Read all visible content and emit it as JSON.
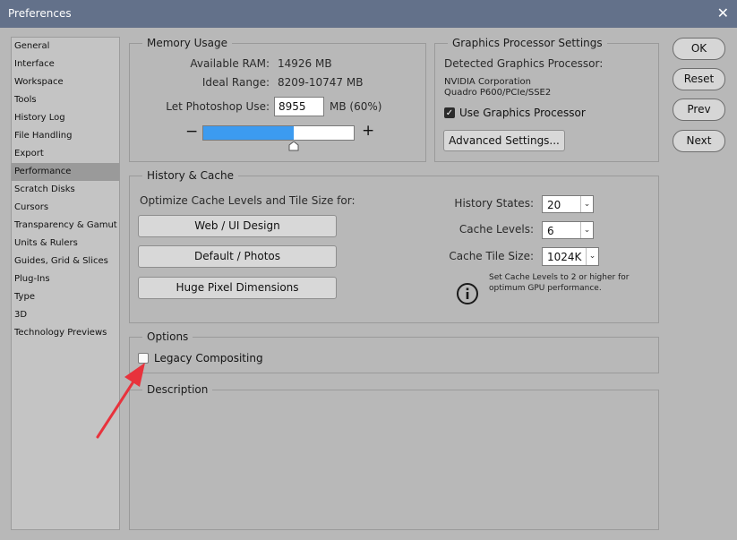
{
  "window": {
    "title": "Preferences",
    "close_glyph": "✕"
  },
  "sidebar": {
    "items": [
      {
        "label": "General"
      },
      {
        "label": "Interface"
      },
      {
        "label": "Workspace"
      },
      {
        "label": "Tools"
      },
      {
        "label": "History Log"
      },
      {
        "label": "File Handling"
      },
      {
        "label": "Export"
      },
      {
        "label": "Performance",
        "selected": true
      },
      {
        "label": "Scratch Disks"
      },
      {
        "label": "Cursors"
      },
      {
        "label": "Transparency & Gamut"
      },
      {
        "label": "Units & Rulers"
      },
      {
        "label": "Guides, Grid & Slices"
      },
      {
        "label": "Plug-Ins"
      },
      {
        "label": "Type"
      },
      {
        "label": "3D"
      },
      {
        "label": "Technology Previews"
      }
    ]
  },
  "memory": {
    "title": "Memory Usage",
    "available_label": "Available RAM:",
    "available_value": "14926 MB",
    "ideal_label": "Ideal Range:",
    "ideal_value": "8209-10747 MB",
    "let_label": "Let Photoshop Use:",
    "let_value": "8955",
    "let_unit": "MB (60%)",
    "slider_fraction": 0.6,
    "minus": "−",
    "plus": "+"
  },
  "gpu": {
    "title": "Graphics Processor Settings",
    "detected_label": "Detected Graphics Processor:",
    "vendor": "NVIDIA Corporation",
    "model": "Quadro P600/PCIe/SSE2",
    "use_gpu_label": "Use Graphics Processor",
    "use_gpu_checked": true,
    "advanced_button": "Advanced Settings..."
  },
  "history": {
    "title": "History & Cache",
    "optimize_label": "Optimize Cache Levels and Tile Size for:",
    "buttons": [
      "Web / UI Design",
      "Default / Photos",
      "Huge Pixel Dimensions"
    ],
    "history_states_label": "History States:",
    "history_states_value": "20",
    "cache_levels_label": "Cache Levels:",
    "cache_levels_value": "6",
    "cache_tile_label": "Cache Tile Size:",
    "cache_tile_value": "1024K",
    "info_line1": "Set Cache Levels to 2 or higher for",
    "info_line2": "optimum GPU performance."
  },
  "options": {
    "title": "Options",
    "legacy_label": "Legacy Compositing",
    "legacy_checked": false
  },
  "description": {
    "title": "Description"
  },
  "actions": {
    "ok": "OK",
    "reset": "Reset",
    "prev": "Prev",
    "next": "Next"
  },
  "colors": {
    "titlebar": "#63718a",
    "slider_fill": "#3c9bf0",
    "arrow": "#e8323c"
  }
}
